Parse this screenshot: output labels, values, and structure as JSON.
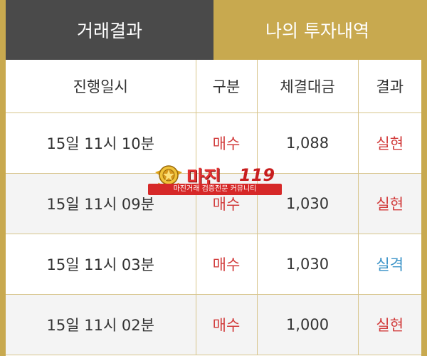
{
  "tabs": [
    {
      "label": "거래결과",
      "active": true
    },
    {
      "label": "나의 투자내역",
      "active": false
    }
  ],
  "table": {
    "headers": [
      "진행일시",
      "구분",
      "체결대금",
      "결과"
    ],
    "rows": [
      {
        "datetime": "15일 11시 10분",
        "type": "매수",
        "amount": "1,088",
        "result": "실현",
        "result_kind": "realized"
      },
      {
        "datetime": "15일 11시 09분",
        "type": "매수",
        "amount": "1,030",
        "result": "실현",
        "result_kind": "realized"
      },
      {
        "datetime": "15일 11시 03분",
        "type": "매수",
        "amount": "1,030",
        "result": "실격",
        "result_kind": "lost"
      },
      {
        "datetime": "15일 11시 02분",
        "type": "매수",
        "amount": "1,000",
        "result": "실현",
        "result_kind": "realized"
      }
    ]
  },
  "watermark": {
    "brand": "마진",
    "number": "119",
    "tagline": "마진거래 검증전문 커뮤니티"
  },
  "colors": {
    "gold": "#c8a94f",
    "active_tab": "#4a4a4a",
    "red": "#d23c3c",
    "blue": "#3a93c8"
  }
}
